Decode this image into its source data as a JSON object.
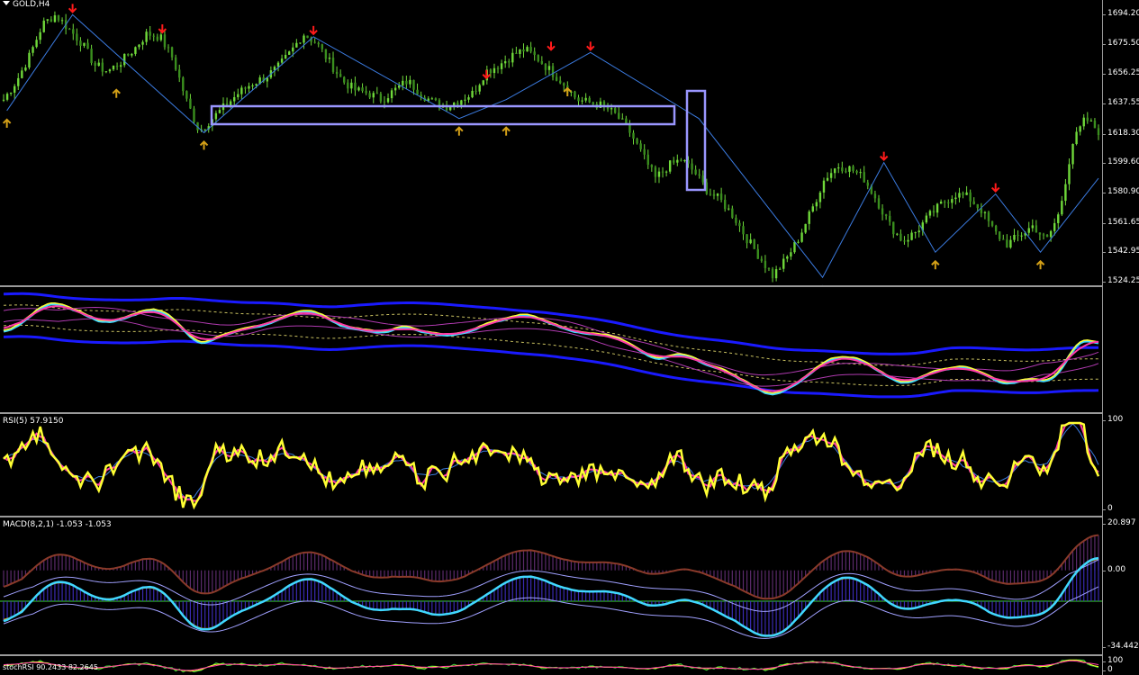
{
  "symbol_title": "GOLD,H4",
  "rsi_title": "RSI(5) 57.9150",
  "macd_title": "MACD(8,2,1) -1.053 -1.053",
  "stoch_title": "stochRSI 90.2433 82.2645",
  "price_ticks": [
    "1694.20",
    "1675.50",
    "1656.25",
    "1637.55",
    "1618.30",
    "1599.60",
    "1580.90",
    "1561.65",
    "1542.95",
    "1524.25"
  ],
  "rsi_ticks": [
    "100",
    "0"
  ],
  "macd_ticks": [
    "20.897",
    "0.00",
    "-34.442"
  ],
  "stoch_ticks": [
    "100",
    "0"
  ],
  "colors": {
    "candle": "#6fd83a",
    "up_arrow": "#d4a017",
    "down_arrow": "#ff1a1a",
    "zigzag": "#3b7be0",
    "box": "#9a96ff",
    "rsi_main": "#ffff33",
    "rsi_sig": "#ff3aa8",
    "rsi_slow": "#3b7be0",
    "macd_hist": "#6a3aa8",
    "macd_line": "#40d8ff",
    "macd_sig": "#d4a017"
  },
  "chart_data": [
    {
      "type": "candlestick",
      "title": "GOLD,H4",
      "ylim": [
        1524.25,
        1694.2
      ],
      "y_ticks": [
        1694.2,
        1675.5,
        1656.25,
        1637.55,
        1618.3,
        1599.6,
        1580.9,
        1561.65,
        1542.95,
        1524.25
      ],
      "close_path": [
        1640,
        1652,
        1668,
        1688,
        1694,
        1685,
        1676,
        1662,
        1658,
        1664,
        1672,
        1682,
        1680,
        1666,
        1640,
        1620,
        1628,
        1636,
        1644,
        1650,
        1654,
        1660,
        1670,
        1682,
        1676,
        1664,
        1652,
        1646,
        1644,
        1640,
        1646,
        1652,
        1644,
        1638,
        1636,
        1640,
        1644,
        1658,
        1662,
        1668,
        1672,
        1666,
        1658,
        1650,
        1640,
        1638,
        1636,
        1630,
        1620,
        1605,
        1590,
        1598,
        1602,
        1594,
        1582,
        1576,
        1566,
        1552,
        1540,
        1528,
        1538,
        1552,
        1570,
        1590,
        1598,
        1596,
        1590,
        1576,
        1560,
        1550,
        1556,
        1566,
        1574,
        1580,
        1578,
        1570,
        1556,
        1548,
        1554,
        1560,
        1550,
        1568,
        1612,
        1628,
        1620
      ],
      "zigzag_points": [
        [
          1.0,
          1638
        ],
        [
          4.0,
          1694
        ],
        [
          14.5,
          1618
        ],
        [
          18.5,
          1682
        ],
        [
          21.5,
          1625
        ],
        [
          27.0,
          1668
        ],
        [
          37.5,
          1528
        ],
        [
          42.5,
          1598
        ],
        [
          47.5,
          1550
        ]
      ],
      "up_arrows": [
        [
          0.3,
          1633
        ],
        [
          10.3,
          1652
        ],
        [
          18.3,
          1619
        ],
        [
          41.6,
          1628
        ],
        [
          45.9,
          1628
        ],
        [
          51.5,
          1653
        ],
        [
          74.8,
          1527
        ],
        [
          85.1,
          1543
        ],
        [
          94.7,
          1543
        ]
      ],
      "down_arrows": [
        [
          6.3,
          1694
        ],
        [
          14.5,
          1681
        ],
        [
          28.3,
          1680
        ],
        [
          44.1,
          1652
        ],
        [
          50.0,
          1670
        ],
        [
          53.6,
          1670
        ],
        [
          80.4,
          1600
        ],
        [
          90.6,
          1580
        ]
      ]
    },
    {
      "type": "line",
      "title": "RSI(5) 57.9150",
      "ylim": [
        0,
        100
      ],
      "last_value": 57.915
    },
    {
      "type": "bar",
      "title": "MACD(8,2,1) -1.053 -1.053",
      "ylim": [
        -34.442,
        20.897
      ],
      "last_values": [
        -1.053,
        -1.053
      ]
    },
    {
      "type": "line",
      "title": "stochRSI 90.2433 82.2645",
      "last_values": [
        90.2433,
        82.2645
      ]
    }
  ]
}
